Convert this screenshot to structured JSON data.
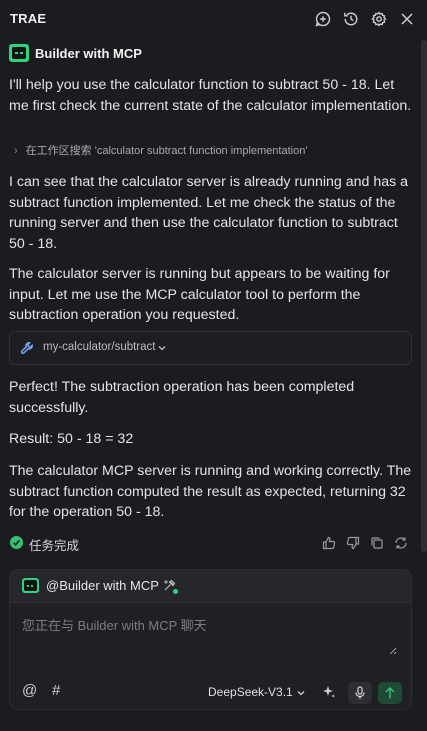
{
  "app": {
    "title": "TRAE"
  },
  "agent": {
    "name": "Builder with MCP"
  },
  "messages": {
    "intro": "I'll help you use the calculator function to subtract 50 - 18. Let me first check the current state of the calculator implementation.",
    "search_label": "在工作区搜索 'calculator subtract function implementation'",
    "para2": "I can see that the calculator server is already running and has a subtract function implemented. Let me check the status of the running server and then use the calculator function to subtract 50 - 18.",
    "para3": "The calculator server is running but appears to be waiting for input. Let me use the MCP calculator tool to perform the subtraction operation you requested.",
    "tool_call": "my-calculator/subtract",
    "para4": "Perfect! The subtraction operation has been completed successfully.",
    "result": "Result: 50 - 18 = 32",
    "para5": "The calculator MCP server is running and working correctly. The subtract function computed the result as expected, returning 32 for the operation 50 - 18."
  },
  "status": {
    "text": "任务完成"
  },
  "chat": {
    "mention": "@Builder with MCP",
    "placeholder": "您正在与 Builder with MCP 聊天",
    "at_symbol": "@",
    "hash_symbol": "#",
    "model": "DeepSeek-V3.1"
  },
  "colors": {
    "accent": "#2ed47a",
    "background": "#1b1c20",
    "send_button": "#1f4a35"
  },
  "icons": [
    "add-chat-icon",
    "history-icon",
    "gear-icon",
    "close-icon",
    "wrench-icon",
    "check-icon",
    "thumbs-up-icon",
    "thumbs-down-icon",
    "copy-icon",
    "refresh-icon",
    "tools-icon",
    "sparkle-icon",
    "mic-icon",
    "send-arrow-icon"
  ]
}
